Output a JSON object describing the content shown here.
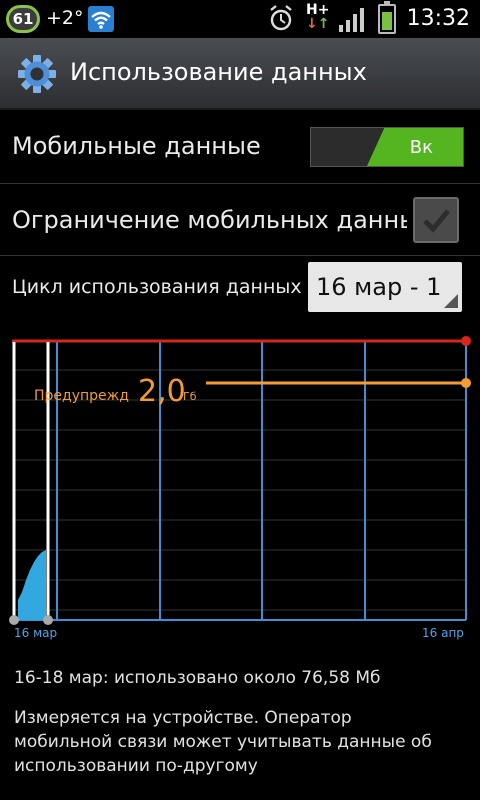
{
  "status_bar": {
    "notification_count": "61",
    "temperature": "+2°",
    "network_type": "H+",
    "time": "13:32",
    "icons": [
      "notification-badge",
      "wifi-icon",
      "alarm-icon",
      "signal-icon",
      "battery-icon"
    ]
  },
  "action_bar": {
    "title": "Использование данных",
    "icon": "gear-icon"
  },
  "mobile_data": {
    "label": "Мобильные данные",
    "toggle_label": "Вк",
    "enabled": true
  },
  "limit": {
    "label": "Ограничение мобильных данных",
    "checked": false
  },
  "cycle": {
    "label": "Цикл использования данных",
    "selected": "16 мар - 1"
  },
  "chart": {
    "start_label": "16 мар",
    "end_label": "16 апр",
    "warning_label": "Предупрежд",
    "warning_value": "2,0",
    "warning_unit": "Гб",
    "colors": {
      "grid": "#3f8fd4",
      "limit": "#d9261c",
      "warning": "#f39c32",
      "usage": "#33a8e0"
    }
  },
  "usage_text": "16-18 мар: использовано около 76,58 Мб",
  "note_text": "Измеряется на устройстве. Оператор мобильной связи может учитывать данные об использовании по-другому"
}
